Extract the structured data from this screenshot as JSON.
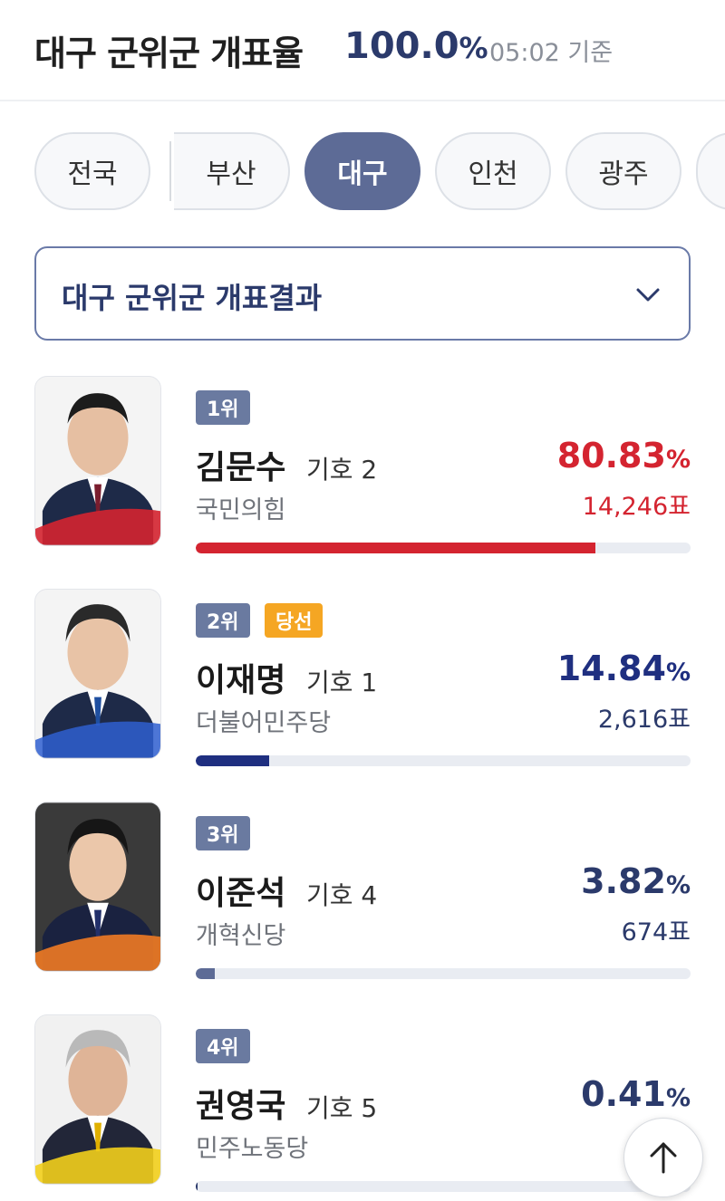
{
  "header": {
    "title": "대구 군위군 개표율",
    "rate": "100.0",
    "rate_unit": "%",
    "time": "05:02 기준"
  },
  "tabs": [
    {
      "label": "전국",
      "active": false
    },
    {
      "label": "부산",
      "active": false
    },
    {
      "label": "대구",
      "active": true
    },
    {
      "label": "인천",
      "active": false
    },
    {
      "label": "광주",
      "active": false
    }
  ],
  "dropdown": {
    "label": "대구 군위군 개표결과",
    "icon": "chevron-down-icon"
  },
  "candidates": [
    {
      "rank": "1위",
      "badge": "",
      "name": "김문수",
      "number": "기호 2",
      "party": "국민의힘",
      "percent": "80.83",
      "percent_unit": "%",
      "votes": "14,246표",
      "share": 0.8083,
      "color": "#d42430"
    },
    {
      "rank": "2위",
      "badge": "당선",
      "name": "이재명",
      "number": "기호 1",
      "party": "더불어민주당",
      "percent": "14.84",
      "percent_unit": "%",
      "votes": "2,616표",
      "share": 0.1484,
      "color": "#1f2f80"
    },
    {
      "rank": "3위",
      "badge": "",
      "name": "이준석",
      "number": "기호 4",
      "party": "개혁신당",
      "percent": "3.82",
      "percent_unit": "%",
      "votes": "674표",
      "share": 0.0382,
      "color": "#2b3a6b"
    },
    {
      "rank": "4위",
      "badge": "",
      "name": "권영국",
      "number": "기호 5",
      "party": "민주노동당",
      "percent": "0.41",
      "percent_unit": "%",
      "votes": "",
      "share": 0.0041,
      "color": "#2b3a6b"
    }
  ],
  "scroll_top_icon": "arrow-up-icon",
  "colors": {
    "accent": "#5d6b96",
    "navy": "#2b3a6b",
    "red": "#d42430",
    "gold": "#f5a623"
  }
}
